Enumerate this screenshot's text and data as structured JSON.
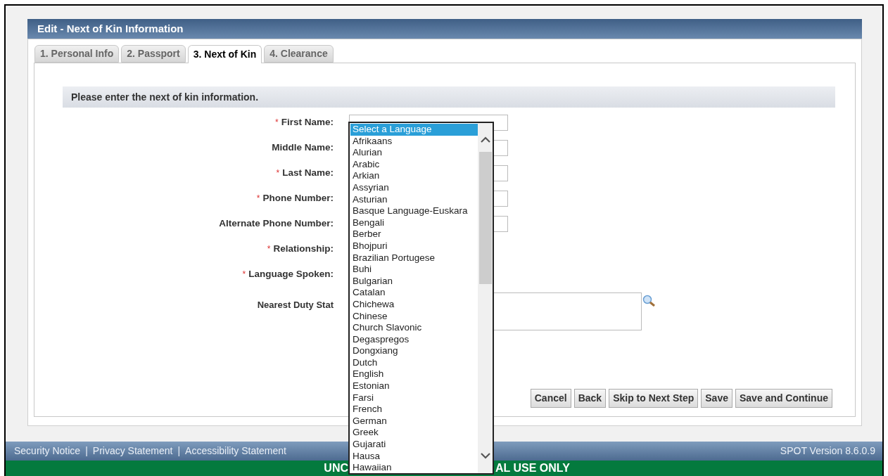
{
  "panel": {
    "title": "Edit - Next of Kin Information"
  },
  "tabs": [
    {
      "label": "1. Personal Info",
      "selected": false
    },
    {
      "label": "2. Passport",
      "selected": false
    },
    {
      "label": "3. Next of Kin",
      "selected": true
    },
    {
      "label": "4. Clearance",
      "selected": false
    }
  ],
  "instructions": "Please enter the next of kin information.",
  "required_marker": "*",
  "fields": [
    {
      "label": "First Name:",
      "required": true,
      "kind": "input"
    },
    {
      "label": "Middle Name:",
      "required": false,
      "kind": "input"
    },
    {
      "label": "Last Name:",
      "required": true,
      "kind": "input"
    },
    {
      "label": "Phone Number:",
      "required": true,
      "kind": "input"
    },
    {
      "label": "Alternate Phone Number:",
      "required": false,
      "kind": "input"
    },
    {
      "label": "Relationship:",
      "required": true,
      "kind": "hidden"
    },
    {
      "label": "Language Spoken:",
      "required": true,
      "kind": "hidden"
    },
    {
      "label": "Nearest Duty Stat",
      "required": false,
      "kind": "lookup"
    }
  ],
  "buttons": [
    "Cancel",
    "Back",
    "Skip to Next Step",
    "Save",
    "Save and Continue"
  ],
  "footer": {
    "links": [
      "Security Notice",
      "Privacy Statement",
      "Accessibility Statement"
    ],
    "separator": "|",
    "version": "SPOT Version 8.6.0.9"
  },
  "banner": {
    "left": "UNC",
    "right": "AL USE ONLY"
  },
  "language_dropdown": [
    {
      "label": "Select a Language",
      "selected": true
    },
    {
      "label": "Afrikaans",
      "selected": false
    },
    {
      "label": "Alurian",
      "selected": false
    },
    {
      "label": "Arabic",
      "selected": false
    },
    {
      "label": "Arkian",
      "selected": false
    },
    {
      "label": "Assyrian",
      "selected": false
    },
    {
      "label": "Asturian",
      "selected": false
    },
    {
      "label": "Basque Language-Euskara",
      "selected": false
    },
    {
      "label": "Bengali",
      "selected": false
    },
    {
      "label": "Berber",
      "selected": false
    },
    {
      "label": "Bhojpuri",
      "selected": false
    },
    {
      "label": "Brazilian Portugese",
      "selected": false
    },
    {
      "label": "Buhi",
      "selected": false
    },
    {
      "label": "Bulgarian",
      "selected": false
    },
    {
      "label": "Catalan",
      "selected": false
    },
    {
      "label": "Chichewa",
      "selected": false
    },
    {
      "label": "Chinese",
      "selected": false
    },
    {
      "label": "Church Slavonic",
      "selected": false
    },
    {
      "label": "Degaspregos",
      "selected": false
    },
    {
      "label": "Dongxiang",
      "selected": false
    },
    {
      "label": "Dutch",
      "selected": false
    },
    {
      "label": "English",
      "selected": false
    },
    {
      "label": "Estonian",
      "selected": false
    },
    {
      "label": "Farsi",
      "selected": false
    },
    {
      "label": "French",
      "selected": false
    },
    {
      "label": "German",
      "selected": false
    },
    {
      "label": "Greek",
      "selected": false
    },
    {
      "label": "Gujarati",
      "selected": false
    },
    {
      "label": "Hausa",
      "selected": false
    },
    {
      "label": "Hawaiian",
      "selected": false
    }
  ]
}
